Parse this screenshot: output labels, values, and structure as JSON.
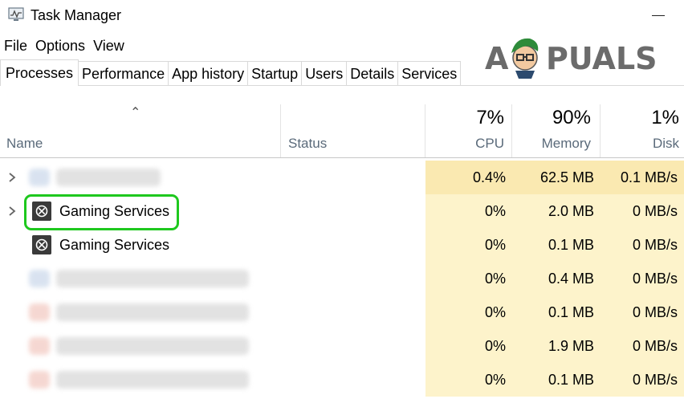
{
  "window": {
    "title": "Task Manager"
  },
  "menu": [
    "File",
    "Options",
    "View"
  ],
  "watermark": {
    "text_left": "A",
    "text_right": "PUALS"
  },
  "tabs": [
    "Processes",
    "Performance",
    "App history",
    "Startup",
    "Users",
    "Details",
    "Services"
  ],
  "active_tab": "Processes",
  "columns": {
    "name": "Name",
    "status": "Status",
    "cpu": {
      "label": "CPU",
      "total": "7%"
    },
    "memory": {
      "label": "Memory",
      "total": "90%"
    },
    "disk": {
      "label": "Disk",
      "total": "1%"
    }
  },
  "rows": [
    {
      "name": "",
      "blurred": true,
      "expandable": true,
      "cpu": "0.4%",
      "memory": "62.5 MB",
      "disk": "0.1 MB/s"
    },
    {
      "name": "Gaming Services",
      "blurred": false,
      "expandable": true,
      "highlighted": true,
      "cpu": "0%",
      "memory": "2.0 MB",
      "disk": "0 MB/s"
    },
    {
      "name": "Gaming Services",
      "blurred": false,
      "expandable": false,
      "cpu": "0%",
      "memory": "0.1 MB",
      "disk": "0 MB/s"
    },
    {
      "name": "",
      "blurred": true,
      "expandable": false,
      "cpu": "0%",
      "memory": "0.4 MB",
      "disk": "0 MB/s"
    },
    {
      "name": "",
      "blurred": true,
      "expandable": false,
      "cpu": "0%",
      "memory": "0.1 MB",
      "disk": "0 MB/s"
    },
    {
      "name": "",
      "blurred": true,
      "expandable": false,
      "cpu": "0%",
      "memory": "1.9 MB",
      "disk": "0 MB/s"
    },
    {
      "name": "",
      "blurred": true,
      "expandable": false,
      "cpu": "0%",
      "memory": "0.1 MB",
      "disk": "0 MB/s"
    }
  ],
  "colors": {
    "cpu_heat_high": "#fae9b1",
    "cell_heat": "#fdf3cb",
    "highlight_border": "#1ec81e",
    "icon_bg": "#3a3a3a"
  },
  "icons": {
    "app": "task-manager-icon",
    "process": "xbox-icon",
    "expander": "chevron-right-icon",
    "sort": "sort-up-icon"
  }
}
